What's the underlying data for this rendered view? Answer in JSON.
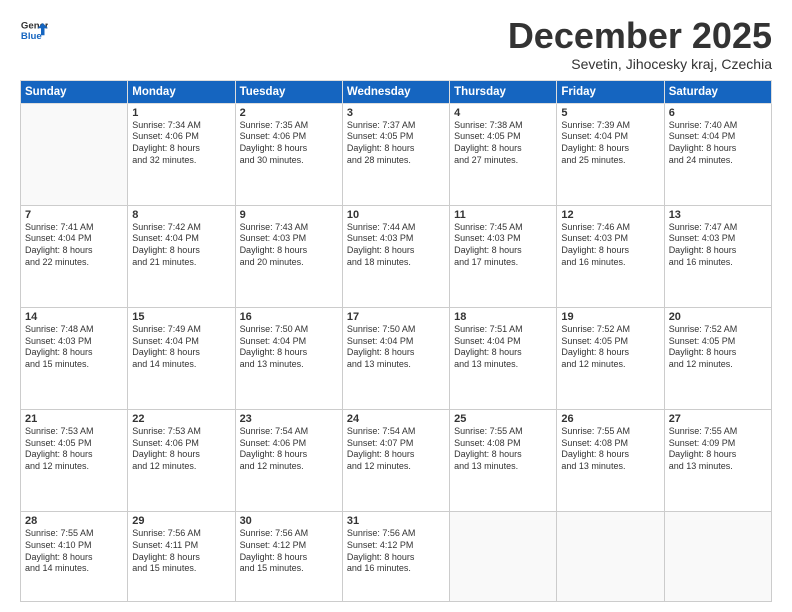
{
  "header": {
    "logo_line1": "General",
    "logo_line2": "Blue",
    "month_title": "December 2025",
    "location": "Sevetin, Jihocesky kraj, Czechia"
  },
  "days_of_week": [
    "Sunday",
    "Monday",
    "Tuesday",
    "Wednesday",
    "Thursday",
    "Friday",
    "Saturday"
  ],
  "weeks": [
    [
      {
        "day": "",
        "info": ""
      },
      {
        "day": "1",
        "info": "Sunrise: 7:34 AM\nSunset: 4:06 PM\nDaylight: 8 hours\nand 32 minutes."
      },
      {
        "day": "2",
        "info": "Sunrise: 7:35 AM\nSunset: 4:06 PM\nDaylight: 8 hours\nand 30 minutes."
      },
      {
        "day": "3",
        "info": "Sunrise: 7:37 AM\nSunset: 4:05 PM\nDaylight: 8 hours\nand 28 minutes."
      },
      {
        "day": "4",
        "info": "Sunrise: 7:38 AM\nSunset: 4:05 PM\nDaylight: 8 hours\nand 27 minutes."
      },
      {
        "day": "5",
        "info": "Sunrise: 7:39 AM\nSunset: 4:04 PM\nDaylight: 8 hours\nand 25 minutes."
      },
      {
        "day": "6",
        "info": "Sunrise: 7:40 AM\nSunset: 4:04 PM\nDaylight: 8 hours\nand 24 minutes."
      }
    ],
    [
      {
        "day": "7",
        "info": "Sunrise: 7:41 AM\nSunset: 4:04 PM\nDaylight: 8 hours\nand 22 minutes."
      },
      {
        "day": "8",
        "info": "Sunrise: 7:42 AM\nSunset: 4:04 PM\nDaylight: 8 hours\nand 21 minutes."
      },
      {
        "day": "9",
        "info": "Sunrise: 7:43 AM\nSunset: 4:03 PM\nDaylight: 8 hours\nand 20 minutes."
      },
      {
        "day": "10",
        "info": "Sunrise: 7:44 AM\nSunset: 4:03 PM\nDaylight: 8 hours\nand 18 minutes."
      },
      {
        "day": "11",
        "info": "Sunrise: 7:45 AM\nSunset: 4:03 PM\nDaylight: 8 hours\nand 17 minutes."
      },
      {
        "day": "12",
        "info": "Sunrise: 7:46 AM\nSunset: 4:03 PM\nDaylight: 8 hours\nand 16 minutes."
      },
      {
        "day": "13",
        "info": "Sunrise: 7:47 AM\nSunset: 4:03 PM\nDaylight: 8 hours\nand 16 minutes."
      }
    ],
    [
      {
        "day": "14",
        "info": "Sunrise: 7:48 AM\nSunset: 4:03 PM\nDaylight: 8 hours\nand 15 minutes."
      },
      {
        "day": "15",
        "info": "Sunrise: 7:49 AM\nSunset: 4:04 PM\nDaylight: 8 hours\nand 14 minutes."
      },
      {
        "day": "16",
        "info": "Sunrise: 7:50 AM\nSunset: 4:04 PM\nDaylight: 8 hours\nand 13 minutes."
      },
      {
        "day": "17",
        "info": "Sunrise: 7:50 AM\nSunset: 4:04 PM\nDaylight: 8 hours\nand 13 minutes."
      },
      {
        "day": "18",
        "info": "Sunrise: 7:51 AM\nSunset: 4:04 PM\nDaylight: 8 hours\nand 13 minutes."
      },
      {
        "day": "19",
        "info": "Sunrise: 7:52 AM\nSunset: 4:05 PM\nDaylight: 8 hours\nand 12 minutes."
      },
      {
        "day": "20",
        "info": "Sunrise: 7:52 AM\nSunset: 4:05 PM\nDaylight: 8 hours\nand 12 minutes."
      }
    ],
    [
      {
        "day": "21",
        "info": "Sunrise: 7:53 AM\nSunset: 4:05 PM\nDaylight: 8 hours\nand 12 minutes."
      },
      {
        "day": "22",
        "info": "Sunrise: 7:53 AM\nSunset: 4:06 PM\nDaylight: 8 hours\nand 12 minutes."
      },
      {
        "day": "23",
        "info": "Sunrise: 7:54 AM\nSunset: 4:06 PM\nDaylight: 8 hours\nand 12 minutes."
      },
      {
        "day": "24",
        "info": "Sunrise: 7:54 AM\nSunset: 4:07 PM\nDaylight: 8 hours\nand 12 minutes."
      },
      {
        "day": "25",
        "info": "Sunrise: 7:55 AM\nSunset: 4:08 PM\nDaylight: 8 hours\nand 13 minutes."
      },
      {
        "day": "26",
        "info": "Sunrise: 7:55 AM\nSunset: 4:08 PM\nDaylight: 8 hours\nand 13 minutes."
      },
      {
        "day": "27",
        "info": "Sunrise: 7:55 AM\nSunset: 4:09 PM\nDaylight: 8 hours\nand 13 minutes."
      }
    ],
    [
      {
        "day": "28",
        "info": "Sunrise: 7:55 AM\nSunset: 4:10 PM\nDaylight: 8 hours\nand 14 minutes."
      },
      {
        "day": "29",
        "info": "Sunrise: 7:56 AM\nSunset: 4:11 PM\nDaylight: 8 hours\nand 15 minutes."
      },
      {
        "day": "30",
        "info": "Sunrise: 7:56 AM\nSunset: 4:12 PM\nDaylight: 8 hours\nand 15 minutes."
      },
      {
        "day": "31",
        "info": "Sunrise: 7:56 AM\nSunset: 4:12 PM\nDaylight: 8 hours\nand 16 minutes."
      },
      {
        "day": "",
        "info": ""
      },
      {
        "day": "",
        "info": ""
      },
      {
        "day": "",
        "info": ""
      }
    ]
  ]
}
